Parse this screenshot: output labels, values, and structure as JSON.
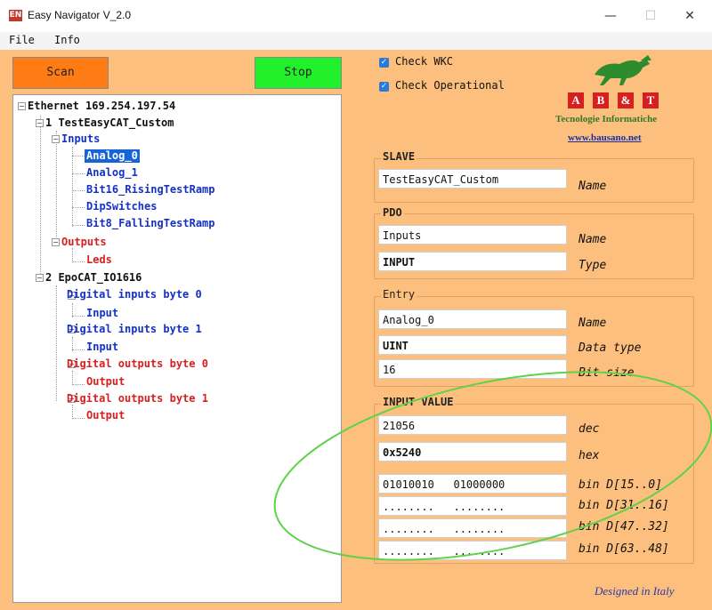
{
  "window": {
    "title": "Easy Navigator V_2.0",
    "minimize": "—",
    "maximize": "☐",
    "close": "✕",
    "icon_text": "EN"
  },
  "menu": {
    "file": "File",
    "info": "Info"
  },
  "buttons": {
    "scan": "Scan",
    "stop": "Stop"
  },
  "checks": {
    "wkc": "Check WKC",
    "operational": "Check Operational",
    "mark": "✓"
  },
  "logo": {
    "letters": [
      "A",
      "B",
      "&",
      "T"
    ],
    "subtitle": "Tecnologie Informatiche",
    "url": "www.bausano.net"
  },
  "tree": {
    "expand_glyph": "−",
    "nodes": [
      "Ethernet 169.254.197.54",
      "1 TestEasyCAT_Custom",
      "Inputs",
      "Analog_0",
      "Analog_1",
      "Bit16_RisingTestRamp",
      "DipSwitches",
      "Bit8_FallingTestRamp",
      "Outputs",
      "Leds",
      "2 EpoCAT_IO1616",
      "Digital inputs byte 0",
      "Input",
      "Digital inputs byte 1",
      "Input",
      "Digital outputs byte 0",
      "Output",
      "Digital outputs byte 1",
      "Output"
    ]
  },
  "slave": {
    "title": "SLAVE",
    "name_value": "TestEasyCAT_Custom",
    "name_label": "Name"
  },
  "pdo": {
    "title": "PDO",
    "name_value": "Inputs",
    "name_label": "Name",
    "type_value": "INPUT",
    "type_label": "Type"
  },
  "entry": {
    "title": "Entry",
    "name_value": "Analog_0",
    "name_label": "Name",
    "datatype_value": "UINT",
    "datatype_label": "Data type",
    "bitsize_value": "16",
    "bitsize_label": "Bit size"
  },
  "input_value": {
    "title": "INPUT VALUE",
    "dec_value": "21056",
    "dec_label": "dec",
    "hex_value": "0x5240",
    "hex_label": "hex",
    "bin_rows": [
      {
        "value": "01010010   01000000",
        "label": "bin D[15..0]"
      },
      {
        "value": "........   ........",
        "label": "bin D[31..16]"
      },
      {
        "value": "........   ........",
        "label": "bin D[47..32]"
      },
      {
        "value": "........   ........",
        "label": "bin D[63..48]"
      }
    ]
  },
  "footer": {
    "designed": "Designed in Italy"
  },
  "colors": {
    "background": "#fdbf7d",
    "scan_button": "#ff7b14",
    "stop_button": "#21f02a",
    "selected": "#1565d8",
    "highlight_ellipse": "#5fd24a",
    "logo_red": "#d42020"
  }
}
